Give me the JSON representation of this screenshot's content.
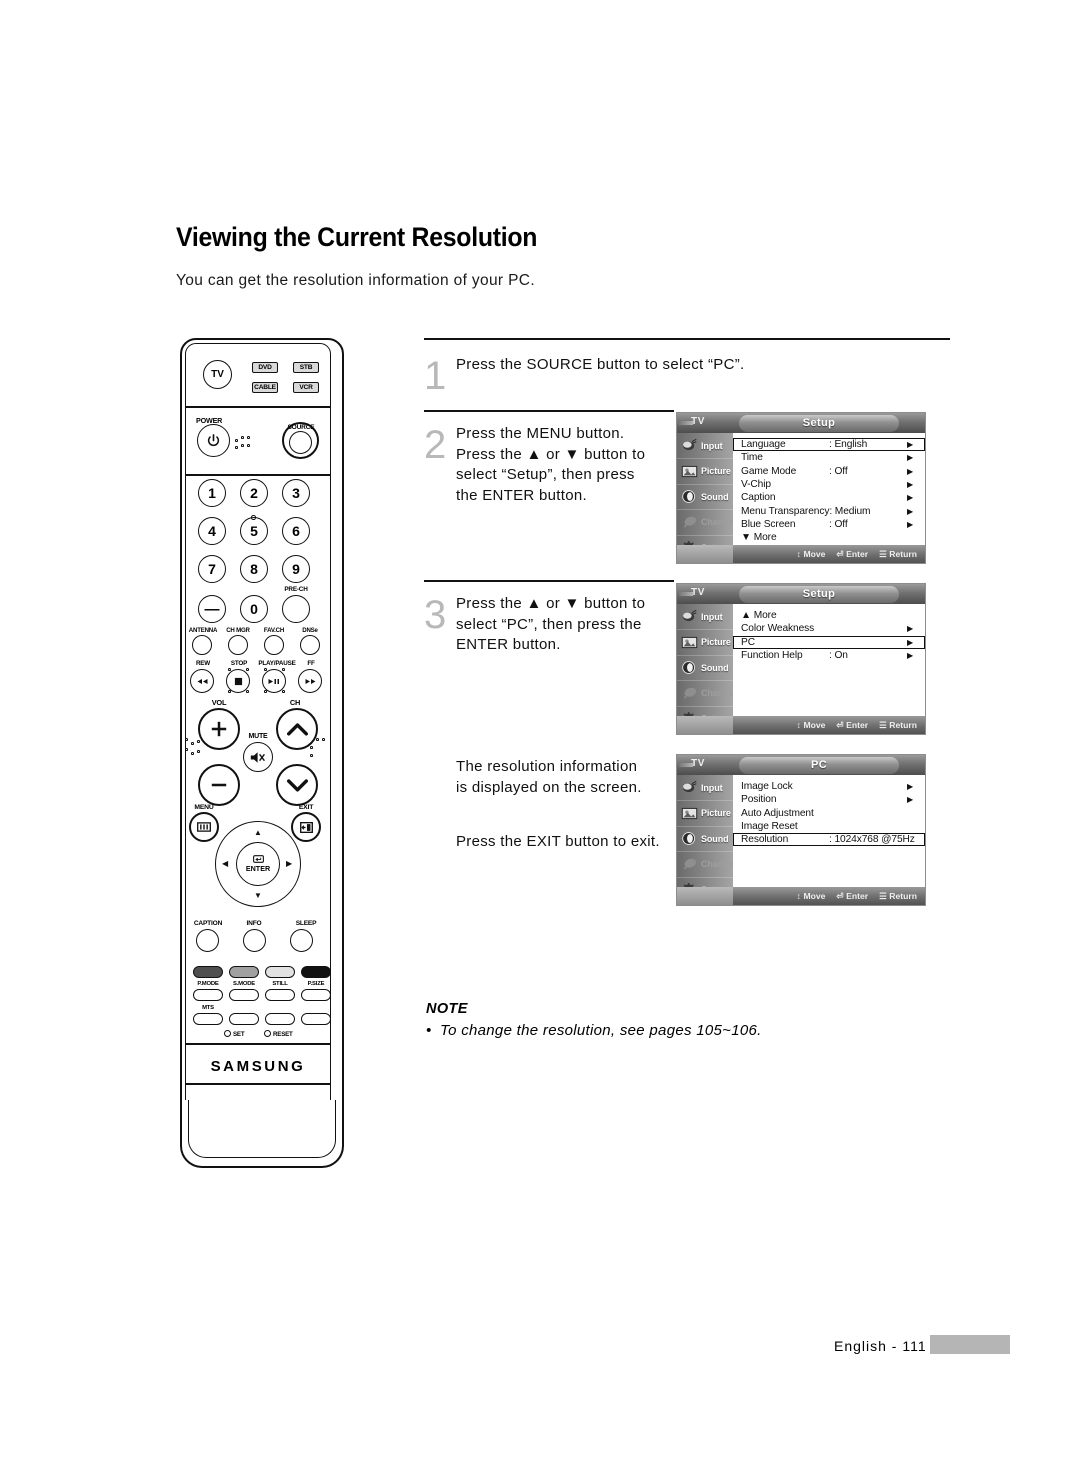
{
  "page_title": "Viewing the Current Resolution",
  "intro_text": "You can get the resolution information of your PC.",
  "steps": [
    {
      "number": "1",
      "text": "Press the SOURCE button to select “PC”."
    },
    {
      "number": "2",
      "text": "Press the MENU button.\nPress the ▲ or ▼ button to\nselect “Setup”, then press\nthe ENTER button."
    },
    {
      "number": "3",
      "text": "Press the ▲ or ▼ button to\nselect “PC”, then press the\nENTER button."
    }
  ],
  "result_text": "The resolution information\nis displayed on the screen.",
  "exit_text": "Press the EXIT button to exit.",
  "note": {
    "title": "NOTE",
    "bullet": "•",
    "item": "To change the resolution, see pages 105~106."
  },
  "footer": {
    "text": "English - 111"
  },
  "osd_sidebar": [
    {
      "label": "Input",
      "icon": "input-icon",
      "state": "normal"
    },
    {
      "label": "Picture",
      "icon": "picture-icon",
      "state": "normal"
    },
    {
      "label": "Sound",
      "icon": "sound-icon",
      "state": "normal"
    },
    {
      "label": "Channel",
      "icon": "channel-icon",
      "state": "dim"
    },
    {
      "label": "Setup",
      "icon": "setup-icon",
      "state": "selected"
    }
  ],
  "osd_footer": {
    "tv_label": "TV",
    "move": "Move",
    "enter": "Enter",
    "return": "Return",
    "move_icon": "up-down-arrow-icon",
    "enter_icon": "enter-key-icon",
    "return_icon": "menu-key-icon"
  },
  "osd_panels": [
    {
      "title": "Setup",
      "rows": [
        {
          "name": "Language",
          "value": ": English",
          "arrow": "▶",
          "highlight": true
        },
        {
          "name": "Time",
          "value": "",
          "arrow": "▶",
          "highlight": false
        },
        {
          "name": "Game Mode",
          "value": ": Off",
          "arrow": "▶",
          "highlight": false
        },
        {
          "name": "V-Chip",
          "value": "",
          "arrow": "▶",
          "highlight": false
        },
        {
          "name": "Caption",
          "value": "",
          "arrow": "▶",
          "highlight": false
        },
        {
          "name": "Menu Transparency",
          "value": ": Medium",
          "arrow": "▶",
          "highlight": false
        },
        {
          "name": "Blue Screen",
          "value": ": Off",
          "arrow": "▶",
          "highlight": false
        },
        {
          "name": "▼ More",
          "value": "",
          "arrow": "",
          "highlight": false
        }
      ]
    },
    {
      "title": "Setup",
      "rows": [
        {
          "name": "▲ More",
          "value": "",
          "arrow": "",
          "highlight": false
        },
        {
          "name": "Color Weakness",
          "value": "",
          "arrow": "▶",
          "highlight": false
        },
        {
          "name": "PC",
          "value": "",
          "arrow": "▶",
          "highlight": true
        },
        {
          "name": "Function Help",
          "value": ": On",
          "arrow": "▶",
          "highlight": false
        }
      ]
    },
    {
      "title": "PC",
      "rows": [
        {
          "name": "Image Lock",
          "value": "",
          "arrow": "▶",
          "highlight": false
        },
        {
          "name": "Position",
          "value": "",
          "arrow": "▶",
          "highlight": false
        },
        {
          "name": "Auto Adjustment",
          "value": "",
          "arrow": "",
          "highlight": false
        },
        {
          "name": "Image Reset",
          "value": "",
          "arrow": "",
          "highlight": false
        },
        {
          "name": "Resolution",
          "value": ": 1024x768 @75Hz",
          "arrow": "",
          "highlight": true
        }
      ]
    }
  ],
  "remote": {
    "brand": "SAMSUNG",
    "mode_buttons": [
      "DVD",
      "STB",
      "CABLE",
      "VCR"
    ],
    "tv_button": "TV",
    "power_label": "POWER",
    "source_label": "SOURCE",
    "numbers": [
      "1",
      "2",
      "3",
      "4",
      "5",
      "6",
      "7",
      "8",
      "9",
      "—",
      "0",
      ""
    ],
    "pre_ch_label": "PRE-CH",
    "function_labels": [
      "ANTENNA",
      "CH MGR",
      "FAV.CH",
      "DNSe"
    ],
    "transport_labels": [
      "REW",
      "STOP",
      "PLAY/PAUSE",
      "FF"
    ],
    "vol_label": "VOL",
    "ch_label": "CH",
    "mute_label": "MUTE",
    "menu_label": "MENU",
    "exit_label": "EXIT",
    "enter_label": "ENTER",
    "bottom_labels": [
      "CAPTION",
      "INFO",
      "SLEEP"
    ],
    "color_labels": [
      "P.MODE",
      "S.MODE",
      "STILL",
      "P.SIZE"
    ],
    "mts_label": "MTS",
    "set_label": "SET",
    "reset_label": "RESET"
  },
  "colors": {
    "step_number": "#b8b8b8",
    "osd_bg": "#cfcfcf",
    "osd_panel": "#ffffff",
    "footer_block": "#b5b5b5"
  }
}
